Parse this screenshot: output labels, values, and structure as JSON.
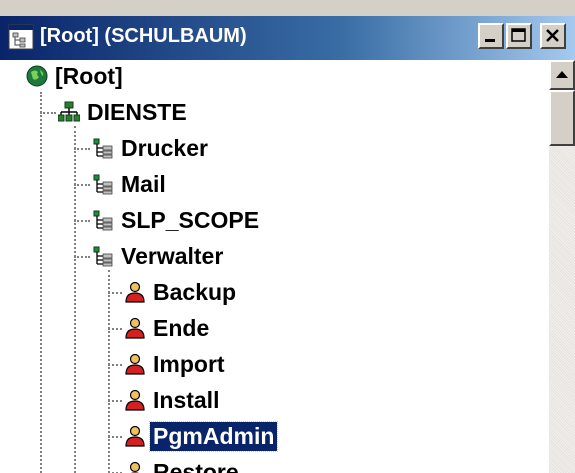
{
  "window": {
    "title": "[Root] (SCHULBAUM)",
    "titlebar_colors": [
      "#0a246a",
      "#a6caf0"
    ],
    "buttons": {
      "minimize": "minimize-icon",
      "maximize": "maximize-icon",
      "close": "close-icon"
    }
  },
  "tree": {
    "root": {
      "label": "[Root]",
      "icon": "globe-icon"
    },
    "dienste": {
      "label": "DIENSTE",
      "icon": "network-icon"
    },
    "children": [
      {
        "label": "Drucker",
        "icon": "container-icon"
      },
      {
        "label": "Mail",
        "icon": "container-icon"
      },
      {
        "label": "SLP_SCOPE",
        "icon": "container-icon"
      },
      {
        "label": "Verwalter",
        "icon": "container-icon"
      }
    ],
    "users": [
      {
        "label": "Backup",
        "icon": "user-icon"
      },
      {
        "label": "Ende",
        "icon": "user-icon"
      },
      {
        "label": "Import",
        "icon": "user-icon"
      },
      {
        "label": "Install",
        "icon": "user-icon"
      },
      {
        "label": "PgmAdmin",
        "icon": "user-icon",
        "selected": true
      },
      {
        "label": "Restore",
        "icon": "user-icon"
      }
    ],
    "selection_color": "#0a246a"
  },
  "scrollbar": {
    "up_icon": "arrow-up-icon"
  }
}
